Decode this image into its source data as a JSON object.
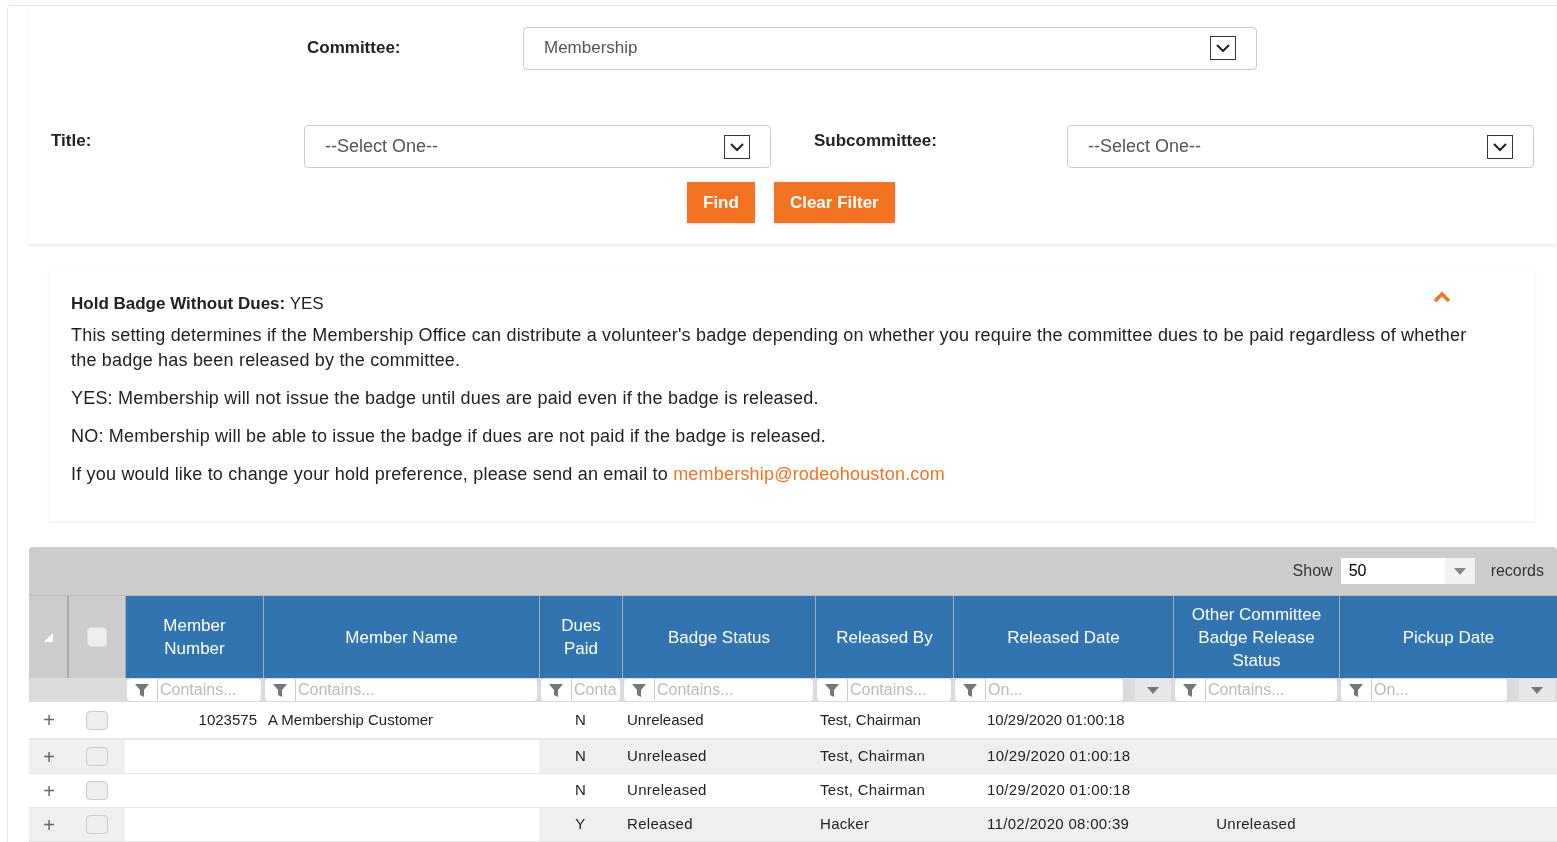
{
  "filters": {
    "committee": {
      "label": "Committee:",
      "value": "Membership"
    },
    "title": {
      "label": "Title:",
      "value": "--Select One--"
    },
    "subcommittee": {
      "label": "Subcommittee:",
      "value": "--Select One--"
    },
    "buttons": [
      "Find",
      "Clear Filter"
    ]
  },
  "info": {
    "heading": "**Hold Badge Without Dues:** YES",
    "expanded": true,
    "paragraphs": [
      "This setting determines if the Membership Office can distribute a volunteer's badge depending on whether you require the committee dues to be paid regardless of whether the badge has been released by the committee.",
      "YES: Membership will not issue the badge until dues are paid even if the badge is released.",
      "NO: Membership will be able to issue the badge if dues are not paid if the badge is released."
    ],
    "contact": "If you would like to change your hold preference, please send an email to ",
    "email": "membership@rodeohouston.com"
  },
  "grid": {
    "select_all_checked": false,
    "show_label": "Show",
    "page_size": "50",
    "records_label": "records",
    "columns": [
      {
        "label": "Member Number",
        "filter": "Contains...",
        "kind": "text"
      },
      {
        "label": "Member Name",
        "filter": "Contains...",
        "kind": "text"
      },
      {
        "label": "Dues Paid",
        "filter": "Conta",
        "kind": "text"
      },
      {
        "label": "Badge Status",
        "filter": "Contains...",
        "kind": "text"
      },
      {
        "label": "Released By",
        "filter": "Contains...",
        "kind": "text"
      },
      {
        "label": "Released Date",
        "filter": "On...",
        "kind": "date"
      },
      {
        "label": "Other Committee Badge Release Status",
        "filter": "Contains...",
        "kind": "text"
      },
      {
        "label": "Pickup Date",
        "filter": "On...",
        "kind": "date"
      }
    ],
    "rows": [
      {
        "expand": "+",
        "checked": false,
        "cells": [
          "1023575",
          "A Membership Customer",
          "N",
          "Unreleased",
          "Test, Chairman",
          "10/29/2020 01:00:18",
          "",
          ""
        ]
      },
      {
        "expand": "+",
        "checked": false,
        "cells": [
          "",
          "",
          "N",
          "Unreleased",
          "Test, Chairman",
          "10/29/2020 01:00:18",
          "",
          ""
        ]
      },
      {
        "expand": "+",
        "checked": false,
        "cells": [
          "",
          "",
          "N",
          "Unreleased",
          "Test, Chairman",
          "10/29/2020 01:00:18",
          "",
          ""
        ]
      },
      {
        "expand": "+",
        "checked": false,
        "cells": [
          "",
          "",
          "Y",
          "Released",
          "Hacker",
          "11/02/2020 08:00:39",
          "Unreleased",
          ""
        ]
      }
    ]
  }
}
